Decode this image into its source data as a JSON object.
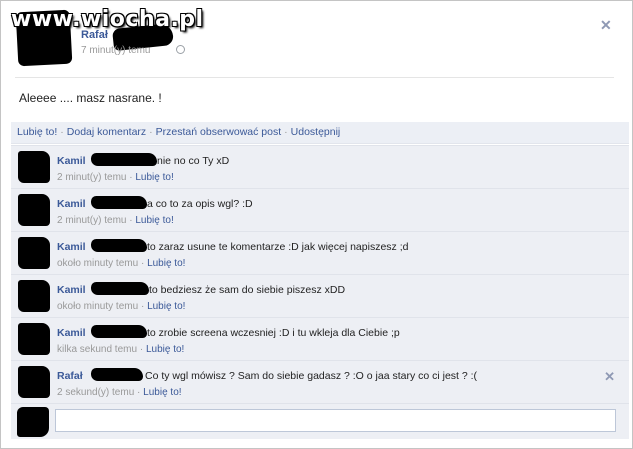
{
  "watermark": {
    "text": "www.wiocha.pl"
  },
  "post": {
    "author": "Rafał",
    "time": "7 minut(y) temu",
    "text": "Aleeee .... masz nasrane. !"
  },
  "actions": {
    "like": "Lubię to!",
    "comment": "Dodaj komentarz",
    "unfollow": "Przestań obserwować post",
    "share": "Udostępnij",
    "separator": "·"
  },
  "comments": [
    {
      "author": "Kamil",
      "text": "nie no co Ty xD",
      "time": "2 minut(y) temu",
      "like": "Lubię to!"
    },
    {
      "author": "Kamil",
      "text": "a co to za opis wgl? :D",
      "time": "2 minut(y) temu",
      "like": "Lubię to!"
    },
    {
      "author": "Kamil",
      "text": "to zaraz usune te komentarze :D jak więcej napiszesz ;d",
      "time": "około minuty temu",
      "like": "Lubię to!"
    },
    {
      "author": "Kamil",
      "text": "to bedziesz że sam do siebie piszesz xDD",
      "time": "około minuty temu",
      "like": "Lubię to!"
    },
    {
      "author": "Kamil",
      "text": "to zrobie screena wczesniej :D i tu wkleja dla Ciebie ;p",
      "time": "kilka sekund temu",
      "like": "Lubię to!"
    },
    {
      "author": "Rafał",
      "text": "Co ty wgl mówisz ? Sam do siebie gadasz ? :O o jaa stary co ci jest ? :(",
      "time": "2 sekund(y) temu",
      "like": "Lubię to!"
    }
  ],
  "reply": {
    "placeholder": ""
  },
  "icons": {
    "close": "close-icon",
    "globe": "globe-icon"
  }
}
